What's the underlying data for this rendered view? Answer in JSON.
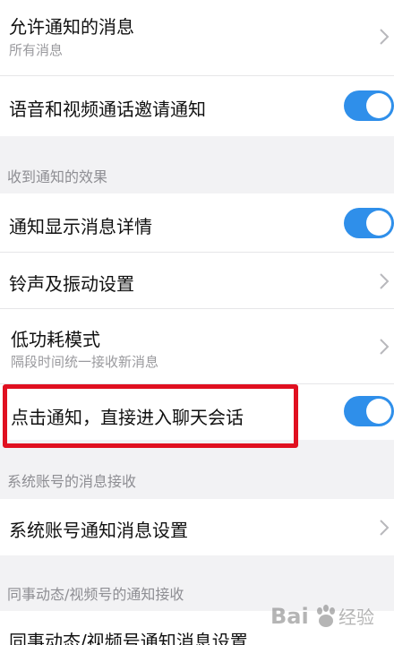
{
  "settings": {
    "allow_notifications": {
      "title": "允许通知的消息",
      "subtitle": "所有消息"
    },
    "voice_video_invite": {
      "title": "语音和视频通话邀请通知",
      "toggle_on": true
    },
    "effects_header": "收到通知的效果",
    "show_details": {
      "title": "通知显示消息详情",
      "toggle_on": true
    },
    "ringtone_vibration": {
      "title": "铃声及振动设置"
    },
    "low_power_mode": {
      "title": "低功耗模式",
      "subtitle": "隔段时间统一接收新消息"
    },
    "tap_to_enter_chat": {
      "title": "点击通知，直接进入聊天会话",
      "toggle_on": true
    },
    "system_account_header": "系统账号的消息接收",
    "system_account_settings": {
      "title": "系统账号通知消息设置"
    },
    "colleague_header": "同事动态/视频号的通知接收",
    "colleague_settings": {
      "title": "同事动态/视频号通知消息设置"
    }
  },
  "colors": {
    "toggle_on": "#2f8fea",
    "highlight": "#e01020",
    "background": "#f2f2f4"
  },
  "icons": {
    "chevron": "chevron-right-icon",
    "watermark": "baidu-logo-icon"
  }
}
